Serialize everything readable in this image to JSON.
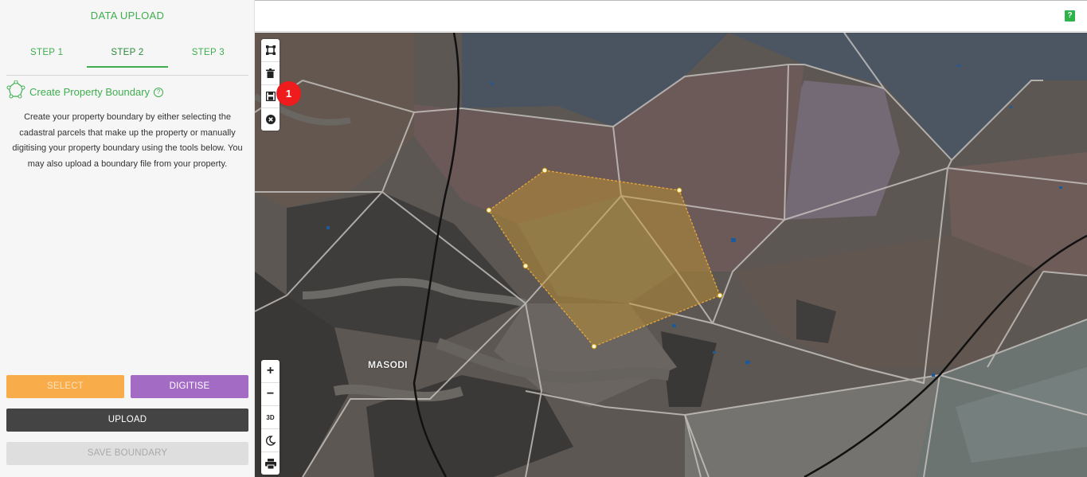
{
  "panel": {
    "title": "DATA UPLOAD",
    "steps": [
      {
        "label": "STEP 1"
      },
      {
        "label": "STEP 2"
      },
      {
        "label": "STEP 3"
      }
    ],
    "active_step": "STEP 2",
    "section_title": "Create Property Boundary",
    "section_help": "?",
    "description": "Create your property boundary by either selecting the cadastral parcels that make up the property or manually digitising your property boundary using the tools below. You may also upload a boundary file from your property.",
    "buttons": {
      "select": "SELECT",
      "digitise": "DIGITISE",
      "upload": "UPLOAD",
      "save_boundary": "SAVE BOUNDARY"
    }
  },
  "top_bar": {
    "help_label": "?"
  },
  "map": {
    "place_label": "MASODI",
    "badge": "1",
    "draw_tools": [
      "polygon-icon",
      "trash-icon",
      "save-icon",
      "close-circle-icon"
    ],
    "nav_tools": [
      "zoom-in-icon",
      "zoom-out-icon",
      "3d-icon",
      "night-mode-icon",
      "print-icon"
    ],
    "zoom_in": "+",
    "zoom_out": "−",
    "three_d": "3D"
  },
  "colors": {
    "accent": "#3fae4f",
    "select": "#f9ac4a",
    "digitise": "#a46bc4",
    "upload": "#444444",
    "save": "#dedede",
    "boundary": "#e8a83a",
    "badge": "#ee1c1c"
  }
}
